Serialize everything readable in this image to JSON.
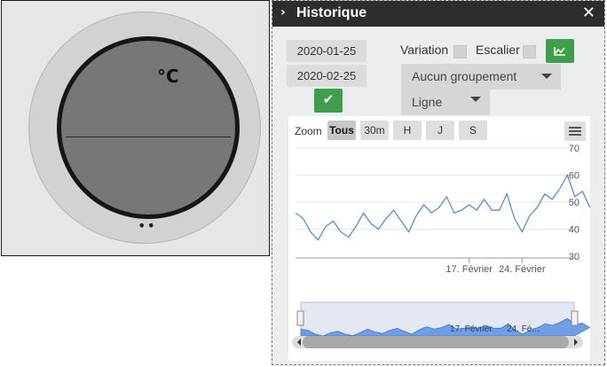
{
  "thermostat": {
    "unit": "°C",
    "indicator": "••"
  },
  "panel": {
    "title": "Historique",
    "close_label": "✕"
  },
  "filters": {
    "start_date": "2020-01-25",
    "end_date": "2020-02-25",
    "variation_label": "Variation",
    "escalier_label": "Escalier",
    "grouping": "Aucun groupement",
    "chart_style": "Ligne"
  },
  "zoom": {
    "label": "Zoom",
    "buttons": [
      "Tous",
      "30m",
      "H",
      "J",
      "S"
    ],
    "active": "Tous"
  },
  "chart_data": {
    "type": "line",
    "y_ticks": [
      70,
      60,
      50,
      40,
      30
    ],
    "ylim": [
      30,
      70
    ],
    "x_ticks": [
      "17. Février",
      "24. Février"
    ],
    "xlim": [
      "2020-01-25",
      "2020-02-25"
    ],
    "navigator_ticks": [
      "17. Février",
      "24. Fé..."
    ],
    "series": [
      {
        "color": "#4a86d8",
        "points": [
          [
            "2020-01-25",
            46
          ],
          [
            "2020-01-26",
            44
          ],
          [
            "2020-01-27",
            39
          ],
          [
            "2020-01-28",
            36
          ],
          [
            "2020-01-29",
            41
          ],
          [
            "2020-01-30",
            43
          ],
          [
            "2020-01-31",
            39
          ],
          [
            "2020-02-01",
            37
          ],
          [
            "2020-02-02",
            41
          ],
          [
            "2020-02-03",
            46
          ],
          [
            "2020-02-04",
            42
          ],
          [
            "2020-02-05",
            40
          ],
          [
            "2020-02-06",
            44
          ],
          [
            "2020-02-07",
            47
          ],
          [
            "2020-02-08",
            43
          ],
          [
            "2020-02-09",
            39
          ],
          [
            "2020-02-10",
            45
          ],
          [
            "2020-02-11",
            49
          ],
          [
            "2020-02-12",
            46
          ],
          [
            "2020-02-13",
            48
          ],
          [
            "2020-02-14",
            52
          ],
          [
            "2020-02-15",
            46
          ],
          [
            "2020-02-16",
            47
          ],
          [
            "2020-02-17",
            49
          ],
          [
            "2020-02-18",
            47
          ],
          [
            "2020-02-19",
            51
          ],
          [
            "2020-02-20",
            47
          ],
          [
            "2020-02-21",
            47
          ],
          [
            "2020-02-22",
            53
          ],
          [
            "2020-02-23",
            44
          ],
          [
            "2020-02-24",
            39
          ],
          [
            "2020-02-25",
            45
          ],
          [
            "2020-02-26",
            48
          ],
          [
            "2020-02-27",
            53
          ],
          [
            "2020-02-28",
            51
          ],
          [
            "2020-02-29",
            55
          ],
          [
            "2020-03-01",
            60
          ],
          [
            "2020-03-02",
            52
          ],
          [
            "2020-03-03",
            54
          ],
          [
            "2020-03-04",
            48
          ]
        ]
      }
    ],
    "grid": true
  }
}
